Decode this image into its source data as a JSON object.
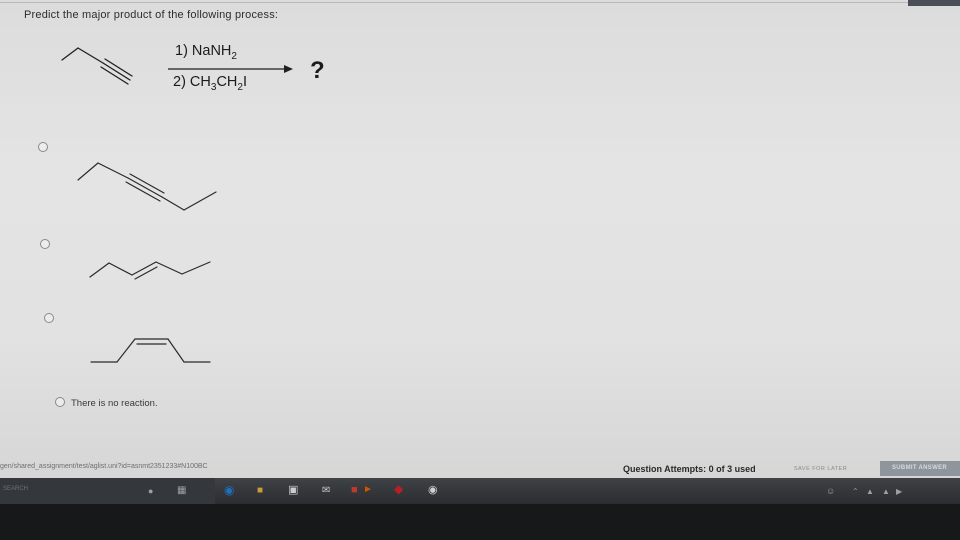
{
  "question": {
    "prompt": "Predict the major product of the following process:",
    "reagent_1": "1) NaNH",
    "reagent_1_sub": "2",
    "reagent_2_a": "2) CH",
    "reagent_2_sub1": "3",
    "reagent_2_b": "CH",
    "reagent_2_sub2": "2",
    "reagent_2_c": "I",
    "product": "?"
  },
  "options": [
    {
      "text": ""
    },
    {
      "text": ""
    },
    {
      "text": ""
    },
    {
      "text": "There is no reaction."
    }
  ],
  "footer": {
    "url": "gen/shared_assignment/test/aglist.uni?id=asnmt2351233#N100BC",
    "attempts": "Question Attempts: 0 of 3 used",
    "save_later": "SAVE FOR LATER",
    "submit": "SUBMIT ANSWER"
  },
  "taskbar": {
    "search": "SEARCH"
  },
  "icons": [
    "microphone-icon",
    "task-view-icon",
    "edge-icon",
    "file-explorer-icon",
    "store-icon",
    "mail-icon",
    "office-icon",
    "mcafee-icon",
    "camera-icon",
    "people-icon",
    "chevron-up-icon",
    "network-icon",
    "volume-icon"
  ],
  "colors": {
    "submit_bg": "#8e959c",
    "taskbar_bg": "#2b2d30"
  }
}
